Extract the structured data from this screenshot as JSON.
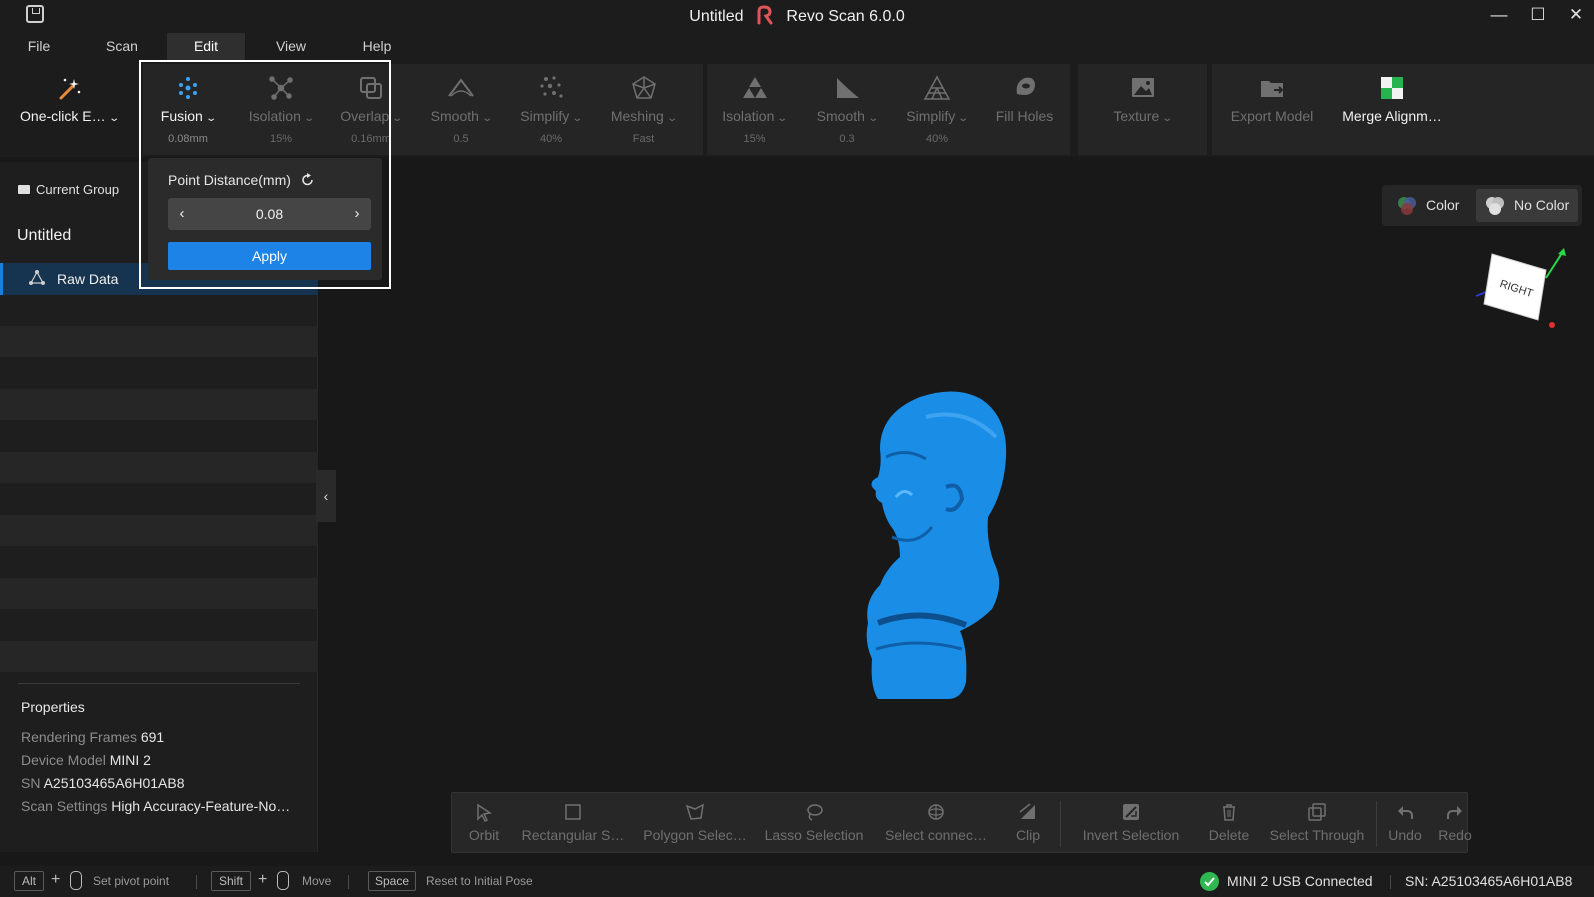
{
  "window": {
    "doc_title": "Untitled",
    "app_title": "Revo Scan 6.0.0",
    "minimize": "—",
    "maximize": "☐",
    "close": "✕"
  },
  "menu": {
    "file": "File",
    "scan": "Scan",
    "edit": "Edit",
    "view": "View",
    "help": "Help"
  },
  "toolbar": {
    "one_click": "One-click E…",
    "fusion": {
      "label": "Fusion",
      "value": "0.08mm"
    },
    "isolation1": {
      "label": "Isolation",
      "value": "15%"
    },
    "overlap": {
      "label": "Overlap",
      "value": "0.16mm"
    },
    "smooth1": {
      "label": "Smooth",
      "value": "0.5"
    },
    "simplify1": {
      "label": "Simplify",
      "value": "40%"
    },
    "meshing": {
      "label": "Meshing",
      "value": "Fast"
    },
    "isolation2": {
      "label": "Isolation",
      "value": "15%"
    },
    "smooth2": {
      "label": "Smooth",
      "value": "0.3"
    },
    "simplify2": {
      "label": "Simplify",
      "value": "40%"
    },
    "fill_holes": "Fill Holes",
    "texture": "Texture",
    "export_model": "Export Model",
    "merge_alignment": "Merge Alignm…"
  },
  "fusion_popup": {
    "label": "Point Distance(mm)",
    "value": "0.08",
    "apply": "Apply"
  },
  "left_panel": {
    "current_group": "Current Group",
    "project_title": "Untitled",
    "raw_data": "Raw Data",
    "properties_title": "Properties",
    "properties": [
      {
        "key": "Rendering Frames",
        "value": "691"
      },
      {
        "key": "Device Model",
        "value": "MINI 2"
      },
      {
        "key": "SN",
        "value": "A25103465A6H01AB8"
      },
      {
        "key": "Scan Settings",
        "value": "High Accuracy-Feature-No…"
      }
    ]
  },
  "viewport": {
    "color_label": "Color",
    "no_color_label": "No Color",
    "view_cube_face": "RIGHT",
    "model_color": "#1a8ee6"
  },
  "bottom_tools": {
    "orbit": "Orbit",
    "rect": "Rectangular S…",
    "polygon": "Polygon Selec…",
    "lasso": "Lasso Selection",
    "select_connected": "Select connec…",
    "clip": "Clip",
    "invert": "Invert Selection",
    "delete": "Delete",
    "select_through": "Select Through",
    "undo": "Undo",
    "redo": "Redo"
  },
  "status": {
    "alt_key": "Alt",
    "pivot": "Set pivot point",
    "shift_key": "Shift",
    "move": "Move",
    "space_key": "Space",
    "reset": "Reset to Initial Pose",
    "connection": "MINI 2 USB Connected",
    "sn": "SN: A25103465A6H01AB8"
  },
  "colors": {
    "accent": "#1e83e6",
    "selection": "#16344f",
    "connected": "#2fb84f"
  }
}
